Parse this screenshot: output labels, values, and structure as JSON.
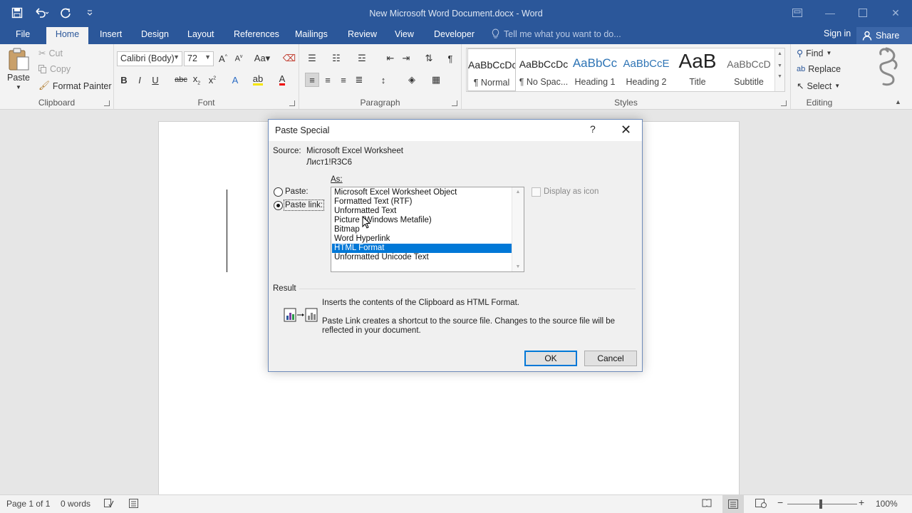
{
  "window": {
    "title": "New Microsoft Word Document.docx - Word",
    "accent": "#2b579a"
  },
  "menu": {
    "tabs": [
      {
        "label": "File"
      },
      {
        "label": "Home"
      },
      {
        "label": "Insert"
      },
      {
        "label": "Design"
      },
      {
        "label": "Layout"
      },
      {
        "label": "References"
      },
      {
        "label": "Mailings"
      },
      {
        "label": "Review"
      },
      {
        "label": "View"
      },
      {
        "label": "Developer"
      }
    ],
    "active_tab": "Home",
    "tell_me": "Tell me what you want to do...",
    "sign_in": "Sign in",
    "share": "Share"
  },
  "ribbon": {
    "clipboard": {
      "label": "Clipboard",
      "paste": "Paste",
      "cut": "Cut",
      "copy": "Copy",
      "format_painter": "Format Painter"
    },
    "font": {
      "label": "Font",
      "font_name": "Calibri (Body)",
      "font_size": "72"
    },
    "paragraph": {
      "label": "Paragraph"
    },
    "styles": {
      "label": "Styles",
      "items": [
        {
          "preview": "AaBbCcDc",
          "name": "¶ Normal"
        },
        {
          "preview": "AaBbCcDc",
          "name": "¶ No Spac..."
        },
        {
          "preview": "AaBbCc",
          "name": "Heading 1"
        },
        {
          "preview": "AaBbCcE",
          "name": "Heading 2"
        },
        {
          "preview": "AaB",
          "name": "Title"
        },
        {
          "preview": "AaBbCcD",
          "name": "Subtitle"
        }
      ]
    },
    "editing": {
      "label": "Editing",
      "find": "Find",
      "replace": "Replace",
      "select": "Select"
    }
  },
  "dialog": {
    "title": "Paste Special",
    "help": "?",
    "source_label": "Source:",
    "source_value": "Microsoft Excel Worksheet",
    "source_ref": "Лист1!R3C6",
    "as_label": "As:",
    "paste_label": "Paste:",
    "paste_link_label": "Paste link:",
    "selected_option": "Paste link",
    "formats": [
      "Microsoft Excel Worksheet Object",
      "Formatted Text (RTF)",
      "Unformatted Text",
      "Picture (Windows Metafile)",
      "Bitmap",
      "Word Hyperlink",
      "HTML Format",
      "Unformatted Unicode Text"
    ],
    "selected_format": "HTML Format",
    "display_as_icon": "Display as icon",
    "display_as_icon_checked": false,
    "result_label": "Result",
    "result_line1": "Inserts the contents of the Clipboard as HTML Format.",
    "result_line2": "Paste Link creates a shortcut to the source file. Changes to the source file will be",
    "result_line3": "reflected in your document.",
    "ok": "OK",
    "cancel": "Cancel"
  },
  "status": {
    "page": "Page 1 of 1",
    "words": "0 words",
    "zoom": "100%"
  }
}
